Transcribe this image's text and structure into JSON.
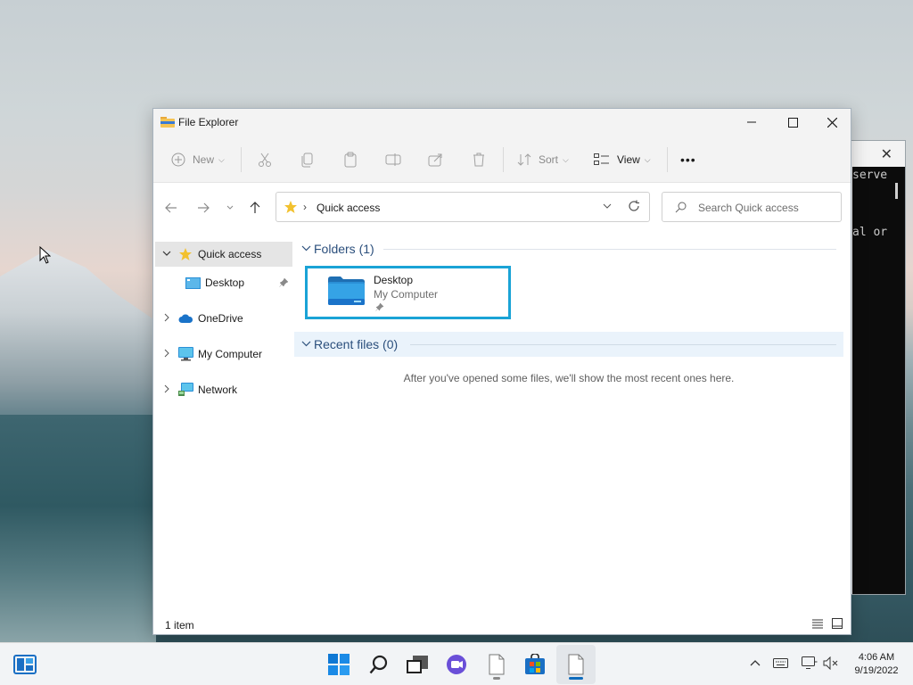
{
  "window": {
    "title": "File Explorer",
    "min_icon": "minimize-icon",
    "max_icon": "maximize-icon",
    "close_icon": "close-icon"
  },
  "toolbar": {
    "new_label": "New",
    "sort_label": "Sort",
    "view_label": "View",
    "more_label": "•••"
  },
  "address": {
    "path": "Quick access",
    "separator": "›"
  },
  "search": {
    "placeholder": "Search Quick access"
  },
  "sidebar": {
    "items": [
      {
        "label": "Quick access"
      },
      {
        "label": "Desktop"
      },
      {
        "label": "OneDrive"
      },
      {
        "label": "My Computer"
      },
      {
        "label": "Network"
      }
    ]
  },
  "content": {
    "folders_header": "Folders (1)",
    "recent_header": "Recent files (0)",
    "folder": {
      "name": "Desktop",
      "location": "My Computer"
    },
    "empty_message": "After you've opened some files, we'll show the most recent ones here."
  },
  "status": {
    "count": "1 item"
  },
  "terminal": {
    "line1": "serve",
    "line2": "al or"
  },
  "clock": {
    "time": "4:06 AM",
    "date": "9/19/2022"
  },
  "colors": {
    "accent": "#1aa3d6",
    "header_text": "#2b4f7c",
    "folder_blue": "#2a8fd6"
  }
}
